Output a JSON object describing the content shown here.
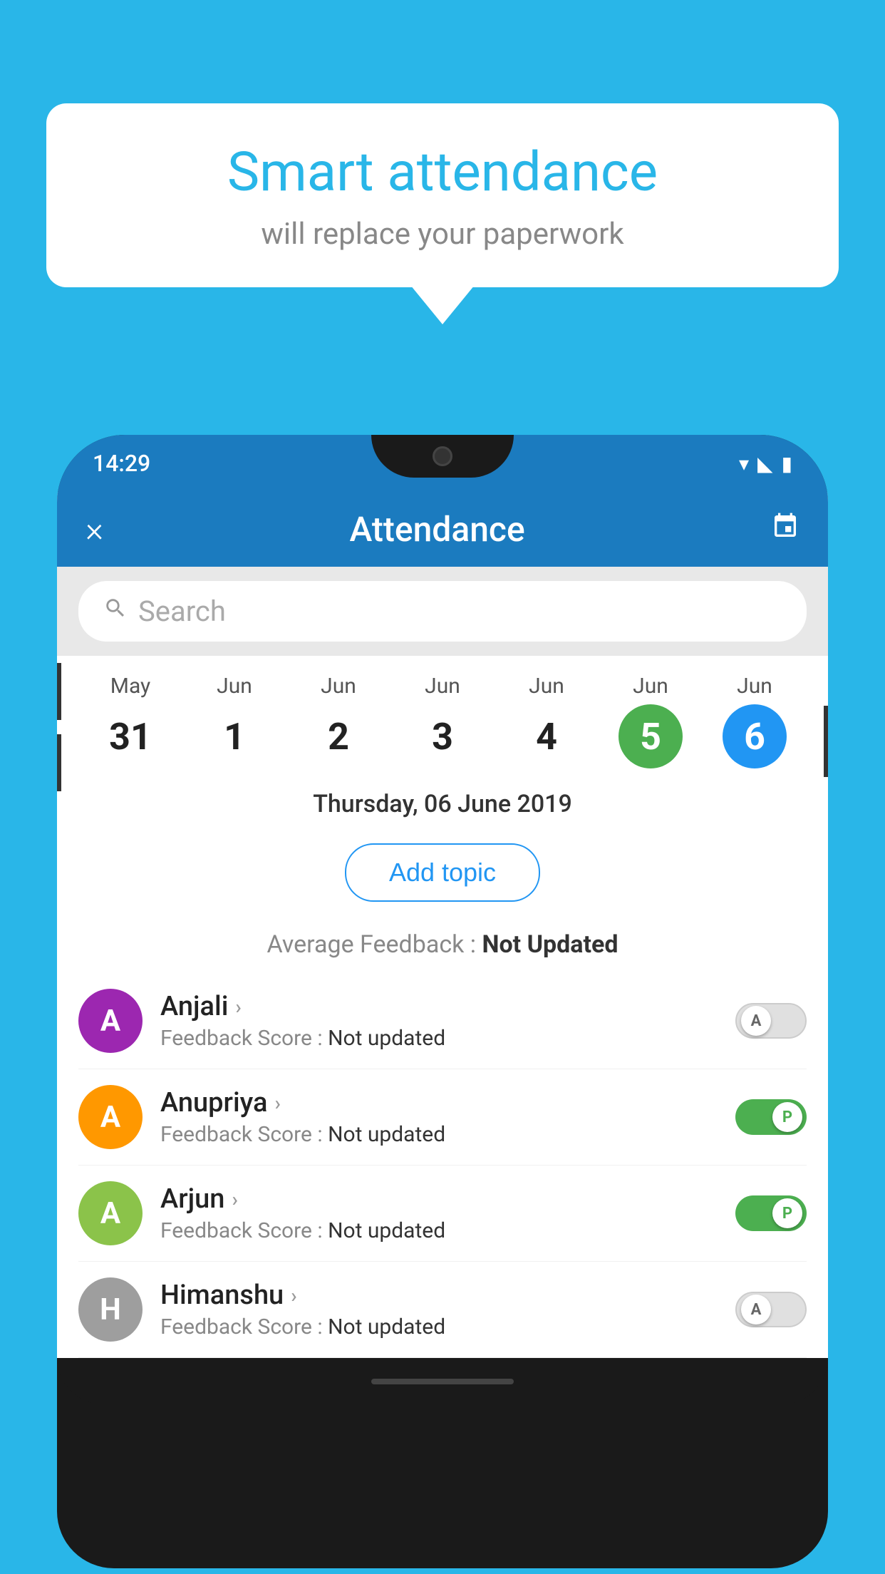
{
  "background_color": "#29b6e8",
  "speech_bubble": {
    "title": "Smart attendance",
    "subtitle": "will replace your paperwork"
  },
  "app": {
    "status_bar": {
      "time": "14:29",
      "icons": [
        "wifi",
        "signal",
        "battery"
      ]
    },
    "header": {
      "close_label": "×",
      "title": "Attendance",
      "calendar_icon": "📅"
    },
    "search": {
      "placeholder": "Search"
    },
    "calendar": {
      "days": [
        {
          "month": "May",
          "date": "31",
          "selected": false
        },
        {
          "month": "Jun",
          "date": "1",
          "selected": false
        },
        {
          "month": "Jun",
          "date": "2",
          "selected": false
        },
        {
          "month": "Jun",
          "date": "3",
          "selected": false
        },
        {
          "month": "Jun",
          "date": "4",
          "selected": false
        },
        {
          "month": "Jun",
          "date": "5",
          "selected": "green"
        },
        {
          "month": "Jun",
          "date": "6",
          "selected": "blue"
        }
      ]
    },
    "selected_date": "Thursday, 06 June 2019",
    "add_topic_label": "Add topic",
    "avg_feedback_label": "Average Feedback : ",
    "avg_feedback_value": "Not Updated",
    "students": [
      {
        "name": "Anjali",
        "avatar_letter": "A",
        "avatar_color": "#9c27b0",
        "feedback_label": "Feedback Score : ",
        "feedback_value": "Not updated",
        "toggle_state": "off",
        "toggle_letter": "A"
      },
      {
        "name": "Anupriya",
        "avatar_letter": "A",
        "avatar_color": "#ff9800",
        "feedback_label": "Feedback Score : ",
        "feedback_value": "Not updated",
        "toggle_state": "on",
        "toggle_letter": "P"
      },
      {
        "name": "Arjun",
        "avatar_letter": "A",
        "avatar_color": "#8bc34a",
        "feedback_label": "Feedback Score : ",
        "feedback_value": "Not updated",
        "toggle_state": "on",
        "toggle_letter": "P"
      },
      {
        "name": "Himanshu",
        "avatar_letter": "H",
        "avatar_color": "#9e9e9e",
        "feedback_label": "Feedback Score : ",
        "feedback_value": "Not updated",
        "toggle_state": "off",
        "toggle_letter": "A"
      }
    ]
  }
}
